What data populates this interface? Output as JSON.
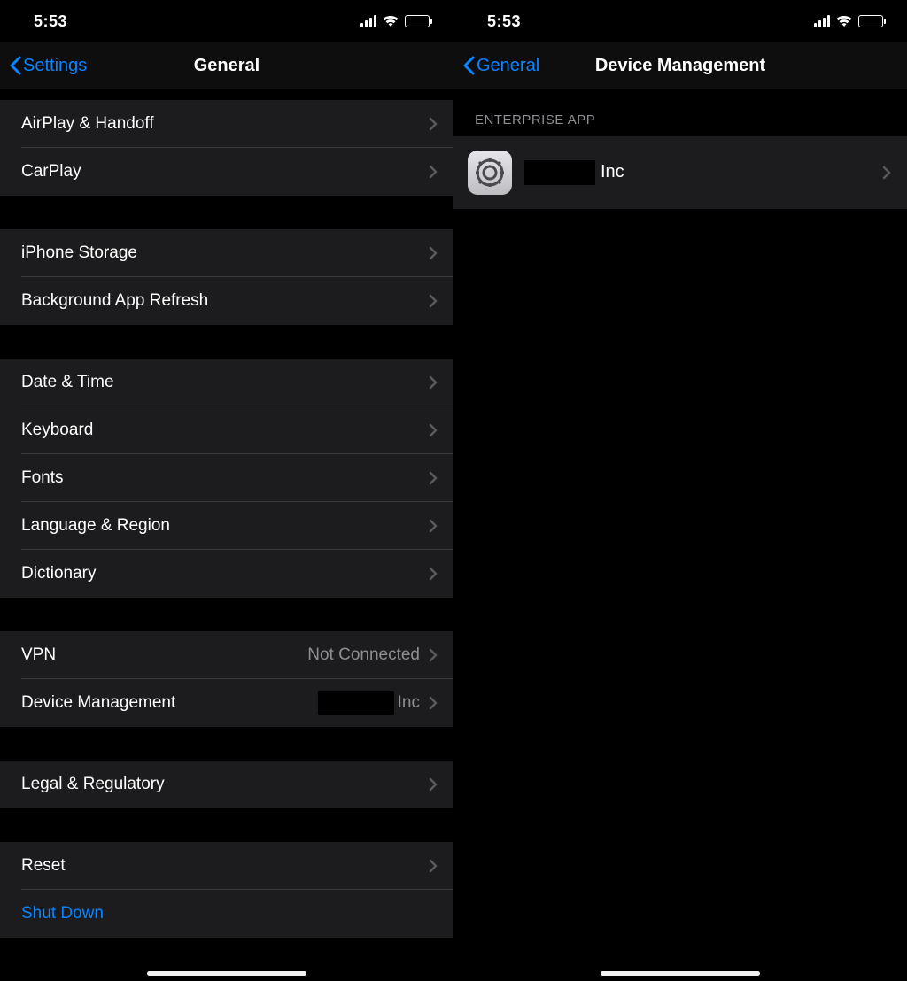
{
  "status": {
    "time": "5:53"
  },
  "left": {
    "nav": {
      "back_label": "Settings",
      "title": "General"
    },
    "groups": [
      {
        "spacer": "small",
        "rows": [
          {
            "label": "AirPlay & Handoff",
            "name": "row-airplay-handoff"
          },
          {
            "label": "CarPlay",
            "name": "row-carplay"
          }
        ]
      },
      {
        "rows": [
          {
            "label": "iPhone Storage",
            "name": "row-iphone-storage"
          },
          {
            "label": "Background App Refresh",
            "name": "row-background-app-refresh"
          }
        ]
      },
      {
        "rows": [
          {
            "label": "Date & Time",
            "name": "row-date-time"
          },
          {
            "label": "Keyboard",
            "name": "row-keyboard"
          },
          {
            "label": "Fonts",
            "name": "row-fonts"
          },
          {
            "label": "Language & Region",
            "name": "row-language-region"
          },
          {
            "label": "Dictionary",
            "name": "row-dictionary"
          }
        ]
      },
      {
        "rows": [
          {
            "label": "VPN",
            "value": "Not Connected",
            "name": "row-vpn"
          },
          {
            "label": "Device Management",
            "value_redacted_suffix": "Inc",
            "name": "row-device-management"
          }
        ]
      },
      {
        "rows": [
          {
            "label": "Legal & Regulatory",
            "name": "row-legal-regulatory"
          }
        ]
      },
      {
        "rows": [
          {
            "label": "Reset",
            "name": "row-reset"
          },
          {
            "label": "Shut Down",
            "link": true,
            "no_chevron": true,
            "name": "row-shut-down"
          }
        ]
      }
    ]
  },
  "right": {
    "nav": {
      "back_label": "General",
      "title": "Device Management"
    },
    "section_header": "ENTERPRISE APP",
    "profile": {
      "redacted_suffix": "Inc"
    }
  }
}
